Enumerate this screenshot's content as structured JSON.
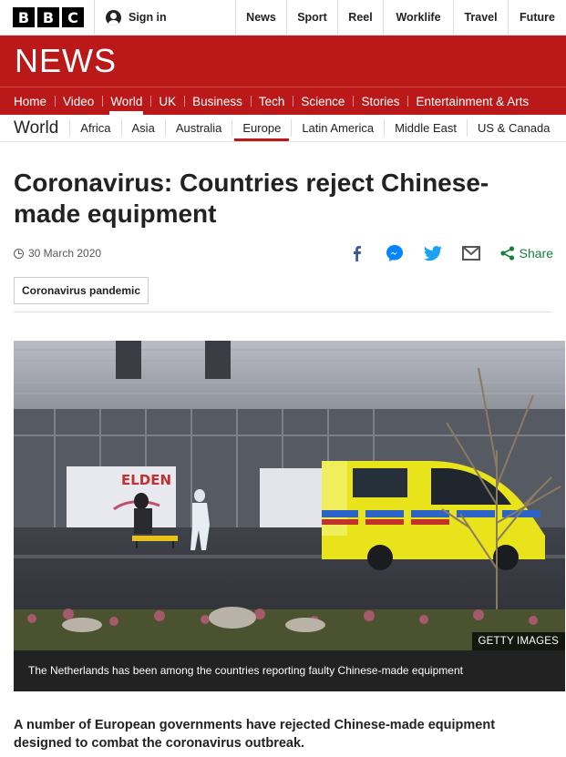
{
  "brand": {
    "letters": [
      "B",
      "B",
      "C"
    ],
    "news_wordmark": "NEWS"
  },
  "account": {
    "signin_label": "Sign in"
  },
  "top_nav": [
    "News",
    "Sport",
    "Reel",
    "Worklife",
    "Travel",
    "Future"
  ],
  "main_nav": {
    "items": [
      "Home",
      "Video",
      "World",
      "UK",
      "Business",
      "Tech",
      "Science",
      "Stories",
      "Entertainment & Arts"
    ],
    "active": "World"
  },
  "sub_nav": {
    "section": "World",
    "items": [
      "Africa",
      "Asia",
      "Australia",
      "Europe",
      "Latin America",
      "Middle East",
      "US & Canada"
    ],
    "active": "Europe"
  },
  "article": {
    "headline": "Coronavirus: Countries reject Chinese-made equipment",
    "date": "30 March 2020",
    "share_label": "Share",
    "share_icons": [
      "facebook-icon",
      "messenger-icon",
      "twitter-icon",
      "email-icon",
      "share-icon"
    ],
    "topic_tag": "Coronavirus pandemic",
    "image": {
      "credit": "GETTY IMAGES",
      "caption": "The Netherlands has been among the countries reporting faulty Chinese-made equipment",
      "banner_text": "ELDEN"
    },
    "lead": "A number of European governments have rejected Chinese-made equipment designed to combat the coronavirus outbreak."
  },
  "colors": {
    "brand_red": "#bb1919",
    "share_green": "#17803d",
    "facebook": "#3b5998",
    "messenger": "#0084ff",
    "twitter": "#1da1f2",
    "ambulance_yellow": "#e8e31b"
  }
}
